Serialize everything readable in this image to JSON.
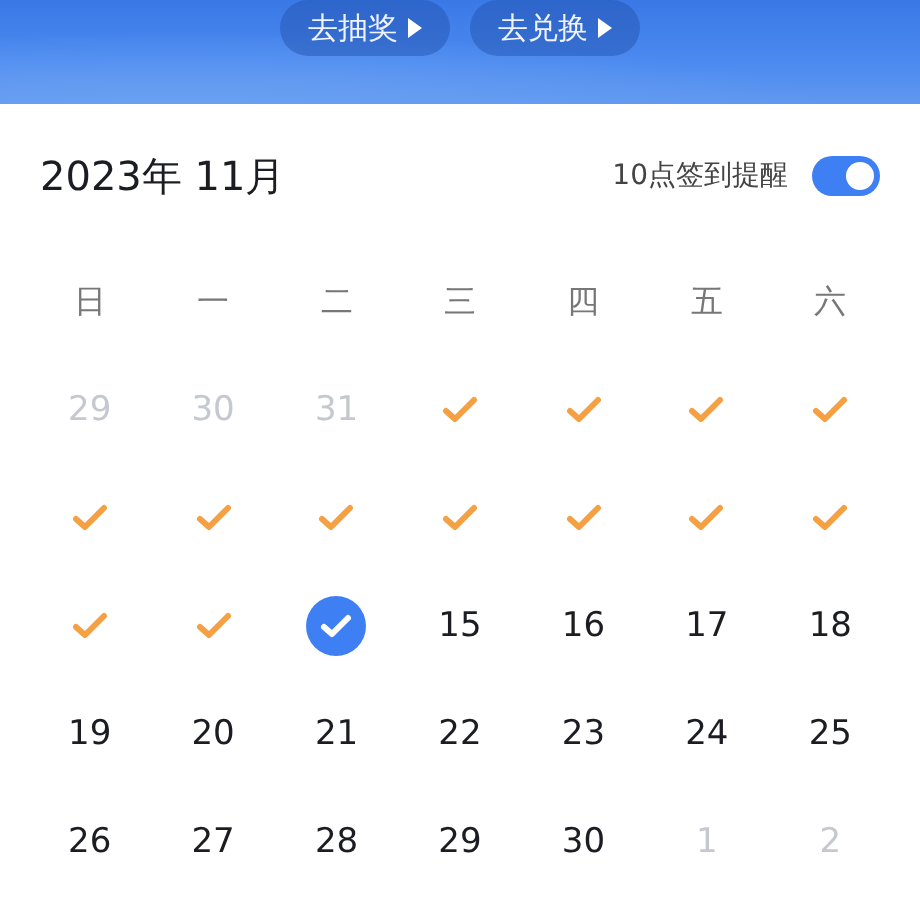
{
  "banner_buttons": [
    {
      "label": "去抽奖"
    },
    {
      "label": "去兑换"
    }
  ],
  "calendar": {
    "title": "2023年 11月",
    "reminder": {
      "label": "10点签到提醒",
      "on": true
    },
    "weekdays": [
      "日",
      "一",
      "二",
      "三",
      "四",
      "五",
      "六"
    ],
    "days": [
      {
        "kind": "other",
        "label": "29"
      },
      {
        "kind": "other",
        "label": "30"
      },
      {
        "kind": "other",
        "label": "31"
      },
      {
        "kind": "checked"
      },
      {
        "kind": "checked"
      },
      {
        "kind": "checked"
      },
      {
        "kind": "checked"
      },
      {
        "kind": "checked"
      },
      {
        "kind": "checked"
      },
      {
        "kind": "checked"
      },
      {
        "kind": "checked"
      },
      {
        "kind": "checked"
      },
      {
        "kind": "checked"
      },
      {
        "kind": "checked"
      },
      {
        "kind": "checked"
      },
      {
        "kind": "checked"
      },
      {
        "kind": "today"
      },
      {
        "kind": "day",
        "label": "15"
      },
      {
        "kind": "day",
        "label": "16"
      },
      {
        "kind": "day",
        "label": "17"
      },
      {
        "kind": "day",
        "label": "18"
      },
      {
        "kind": "day",
        "label": "19"
      },
      {
        "kind": "day",
        "label": "20"
      },
      {
        "kind": "day",
        "label": "21"
      },
      {
        "kind": "day",
        "label": "22"
      },
      {
        "kind": "day",
        "label": "23"
      },
      {
        "kind": "day",
        "label": "24"
      },
      {
        "kind": "day",
        "label": "25"
      },
      {
        "kind": "day",
        "label": "26"
      },
      {
        "kind": "day",
        "label": "27"
      },
      {
        "kind": "day",
        "label": "28"
      },
      {
        "kind": "day",
        "label": "29"
      },
      {
        "kind": "day",
        "label": "30"
      },
      {
        "kind": "other",
        "label": "1"
      },
      {
        "kind": "other",
        "label": "2"
      }
    ]
  }
}
